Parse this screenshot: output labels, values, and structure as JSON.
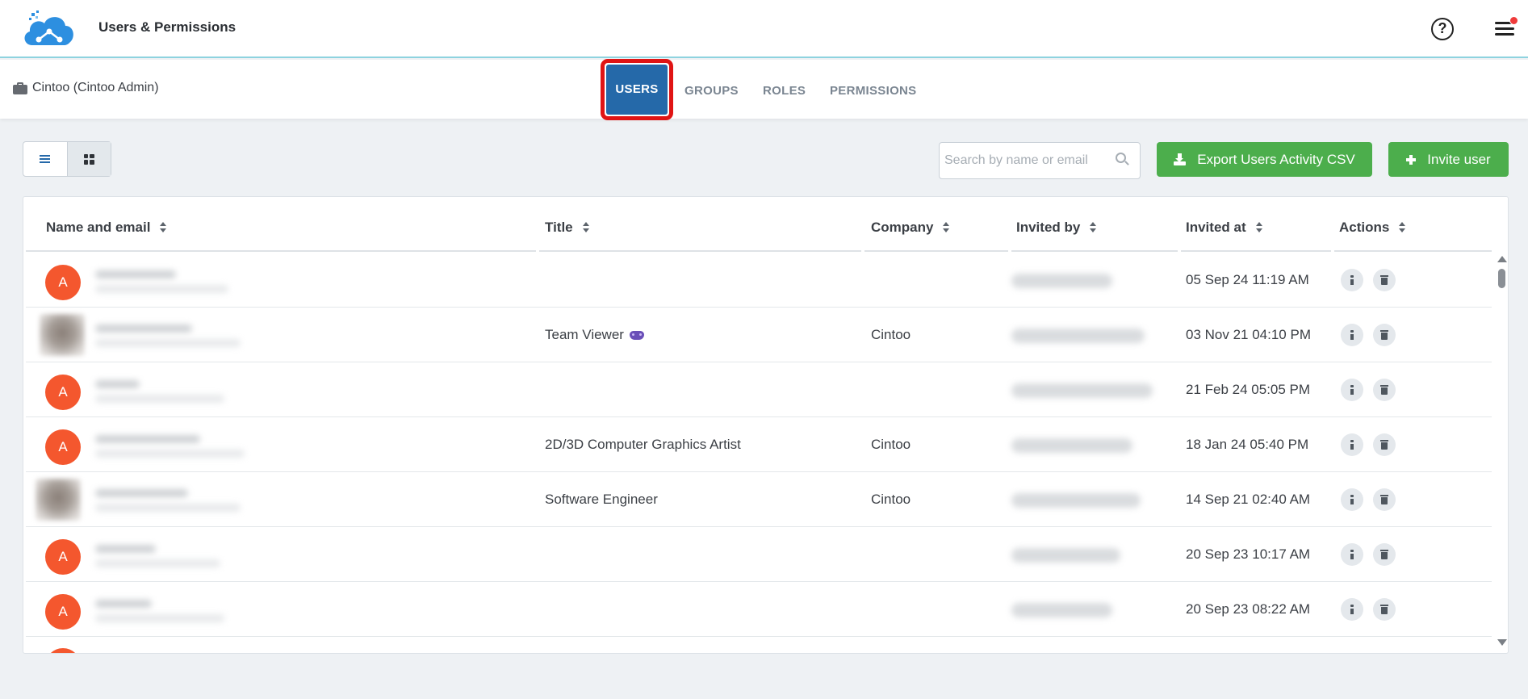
{
  "app": {
    "title": "Users & Permissions",
    "brand_color": "#2d8fe0",
    "icons": {
      "help": "help-circle-icon",
      "menu": "hamburger-menu-icon"
    }
  },
  "subheader": {
    "organization": "Cintoo (Cintoo Admin)",
    "tabs": [
      {
        "label": "USERS",
        "active": true
      },
      {
        "label": "GROUPS",
        "active": false
      },
      {
        "label": "ROLES",
        "active": false
      },
      {
        "label": "PERMISSIONS",
        "active": false
      }
    ],
    "active_tab_color": "#2569a9",
    "highlight_color": "#e01414"
  },
  "toolbar": {
    "search_placeholder": "Search by name or email",
    "export_label": "Export Users Activity CSV",
    "invite_label": "Invite user",
    "button_color": "#4cae4c"
  },
  "table": {
    "columns": [
      "Name and email",
      "Title",
      "Company",
      "Invited by",
      "Invited at",
      "Actions"
    ],
    "rows": [
      {
        "avatar": "A",
        "title": "",
        "company": "",
        "invited_at": "05 Sep 24 11:19 AM"
      },
      {
        "avatar": "photo",
        "title": "Team Viewer",
        "title_icon": "gamepad-icon",
        "company": "Cintoo",
        "invited_at": "03 Nov 21 04:10 PM"
      },
      {
        "avatar": "A",
        "title": "",
        "company": "",
        "invited_at": "21 Feb 24 05:05 PM"
      },
      {
        "avatar": "A",
        "title": "2D/3D Computer Graphics Artist",
        "company": "Cintoo",
        "invited_at": "18 Jan 24 05:40 PM"
      },
      {
        "avatar": "photo",
        "title": "Software Engineer",
        "company": "Cintoo",
        "invited_at": "14 Sep 21 02:40 AM"
      },
      {
        "avatar": "A",
        "title": "",
        "company": "",
        "invited_at": "20 Sep 23 10:17 AM"
      },
      {
        "avatar": "A",
        "title": "",
        "company": "",
        "invited_at": "20 Sep 23 08:22 AM"
      }
    ],
    "avatar_color": "#f4572e"
  }
}
